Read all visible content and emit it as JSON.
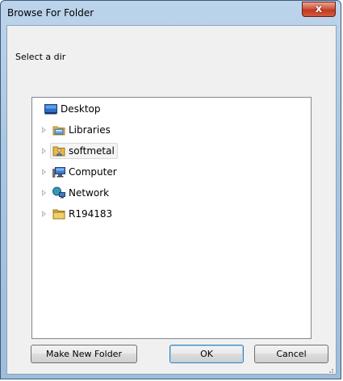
{
  "window": {
    "title": "Browse For Folder",
    "close_label": "x"
  },
  "dialog": {
    "prompt": "Select a dir"
  },
  "tree": {
    "items": [
      {
        "label": "Desktop",
        "icon": "desktop-icon",
        "expandable": false,
        "selected": false
      },
      {
        "label": "Libraries",
        "icon": "libraries-icon",
        "expandable": true,
        "selected": false
      },
      {
        "label": "softmetal",
        "icon": "user-folder-icon",
        "expandable": true,
        "selected": true
      },
      {
        "label": "Computer",
        "icon": "computer-icon",
        "expandable": true,
        "selected": false
      },
      {
        "label": "Network",
        "icon": "network-icon",
        "expandable": true,
        "selected": false
      },
      {
        "label": "R194183",
        "icon": "folder-icon",
        "expandable": true,
        "selected": false
      }
    ]
  },
  "buttons": {
    "new_folder": "Make New Folder",
    "ok": "OK",
    "cancel": "Cancel"
  },
  "colors": {
    "title_bar": "#a9c6e2",
    "close_button": "#c03a22",
    "dialog_background": "#f0f0f0",
    "default_button_border": "#3c7fb1"
  }
}
